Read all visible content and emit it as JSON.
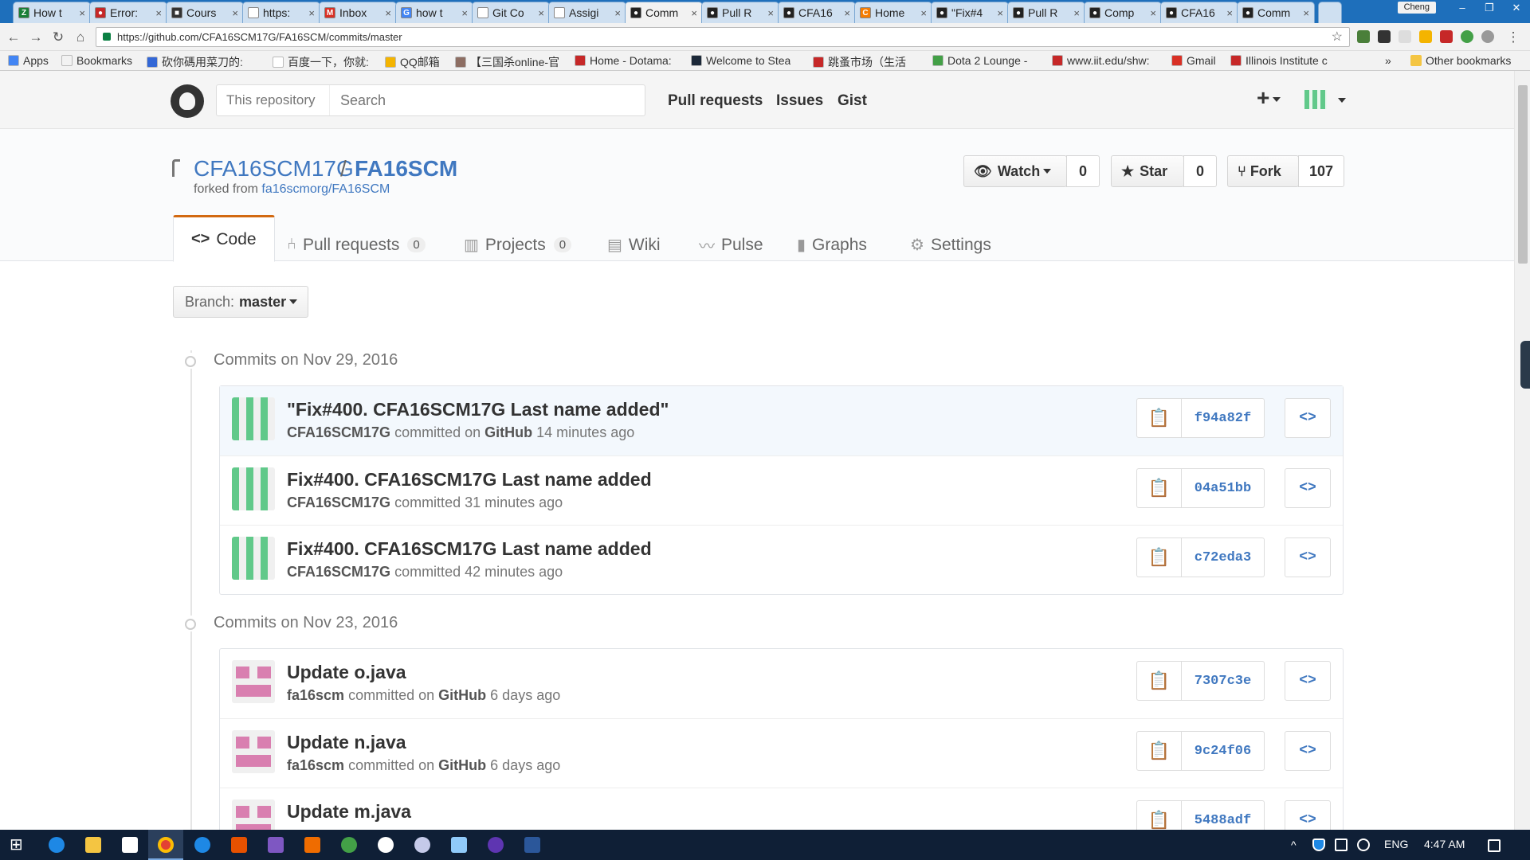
{
  "browser": {
    "tabs": [
      {
        "label": "How t",
        "color": "#1a7f37",
        "glyph": "Z"
      },
      {
        "label": "Error:",
        "color": "#c62828",
        "glyph": "●"
      },
      {
        "label": "Cours",
        "color": "#333333",
        "glyph": "■"
      },
      {
        "label": "https:",
        "color": "#ffffff",
        "glyph": ""
      },
      {
        "label": "Inbox",
        "color": "#d93025",
        "glyph": "M"
      },
      {
        "label": "how t",
        "color": "#4285f4",
        "glyph": "G"
      },
      {
        "label": "Git Co",
        "color": "#ffffff",
        "glyph": ""
      },
      {
        "label": "Assigi",
        "color": "#ffffff",
        "glyph": ""
      },
      {
        "label": "Comm",
        "color": "#222222",
        "glyph": "●"
      },
      {
        "label": "Pull R",
        "color": "#222222",
        "glyph": "●"
      },
      {
        "label": "CFA16",
        "color": "#222222",
        "glyph": "●"
      },
      {
        "label": "Home",
        "color": "#f57c00",
        "glyph": "C"
      },
      {
        "label": "\"Fix#4",
        "color": "#222222",
        "glyph": "●"
      },
      {
        "label": "Pull R",
        "color": "#222222",
        "glyph": "●"
      },
      {
        "label": "Comp",
        "color": "#222222",
        "glyph": "●"
      },
      {
        "label": "CFA16",
        "color": "#222222",
        "glyph": "●"
      },
      {
        "label": "Comm",
        "color": "#222222",
        "glyph": "●"
      }
    ],
    "user": "Cheng",
    "url": "https://github.com/CFA16SCM17G/FA16SCM/commits/master",
    "bookmarks": [
      {
        "label": "Apps",
        "color": "#4285f4"
      },
      {
        "label": "Bookmarks",
        "color": "#f2f2f2"
      },
      {
        "label": "砍你碼用菜刀的:",
        "color": "#3367d6"
      },
      {
        "label": "百度一下，你就:",
        "color": "#ffffff"
      },
      {
        "label": "QQ邮箱",
        "color": "#f4b400"
      },
      {
        "label": "【三国杀online-官",
        "color": "#8d6e63"
      },
      {
        "label": "Home - Dotama:",
        "color": "#c62828"
      },
      {
        "label": "Welcome to Stea",
        "color": "#1b2838"
      },
      {
        "label": "跳蚤市场（生活",
        "color": "#c62828"
      },
      {
        "label": "Dota 2 Lounge -",
        "color": "#43a047"
      },
      {
        "label": "www.iit.edu/shw:",
        "color": "#c62828"
      },
      {
        "label": "Gmail",
        "color": "#d93025"
      },
      {
        "label": "Illinois Institute c",
        "color": "#c62828"
      }
    ],
    "other_bookmarks": "Other bookmarks",
    "more_bookmarks": "»"
  },
  "github": {
    "search_scope": "This repository",
    "search_placeholder": "Search",
    "nav": [
      "Pull requests",
      "Issues",
      "Gist"
    ],
    "plus": "+"
  },
  "repo": {
    "owner": "CFA16SCM17G",
    "slash": "/",
    "name": "FA16SCM",
    "forked_prefix": "forked from",
    "forked_from": "fa16scmorg/FA16SCM",
    "watch_label": "Watch",
    "watch_count": "0",
    "star_label": "Star",
    "star_count": "0",
    "fork_label": "Fork",
    "fork_count": "107",
    "tabs": {
      "code": "Code",
      "pull_requests": "Pull requests",
      "pull_requests_count": "0",
      "projects": "Projects",
      "projects_count": "0",
      "wiki": "Wiki",
      "pulse": "Pulse",
      "graphs": "Graphs",
      "settings": "Settings"
    },
    "branch_prefix": "Branch:",
    "branch": "master"
  },
  "commit_groups": [
    {
      "heading": "Commits on Nov 29, 2016",
      "commits": [
        {
          "title": "\"Fix#400. CFA16SCM17G Last name added\"",
          "author": "CFA16SCM17G",
          "verb": "committed on",
          "via": "GitHub",
          "time": "14 minutes ago",
          "sha": "f94a82f",
          "avatar": "green"
        },
        {
          "title": "Fix#400. CFA16SCM17G Last name added",
          "author": "CFA16SCM17G",
          "verb": "committed",
          "via": "",
          "time": "31 minutes ago",
          "sha": "04a51bb",
          "avatar": "green"
        },
        {
          "title": "Fix#400. CFA16SCM17G Last name added",
          "author": "CFA16SCM17G",
          "verb": "committed",
          "via": "",
          "time": "42 minutes ago",
          "sha": "c72eda3",
          "avatar": "green"
        }
      ]
    },
    {
      "heading": "Commits on Nov 23, 2016",
      "commits": [
        {
          "title": "Update o.java",
          "author": "fa16scm",
          "verb": "committed on",
          "via": "GitHub",
          "time": "6 days ago",
          "sha": "7307c3e",
          "avatar": "pink"
        },
        {
          "title": "Update n.java",
          "author": "fa16scm",
          "verb": "committed on",
          "via": "GitHub",
          "time": "6 days ago",
          "sha": "9c24f06",
          "avatar": "pink"
        },
        {
          "title": "Update m.java",
          "author": "",
          "verb": "",
          "via": "",
          "time": "",
          "sha": "5488adf",
          "avatar": "pink"
        }
      ]
    }
  ],
  "taskbar": {
    "lang": "ENG",
    "time": "4:47 AM"
  }
}
